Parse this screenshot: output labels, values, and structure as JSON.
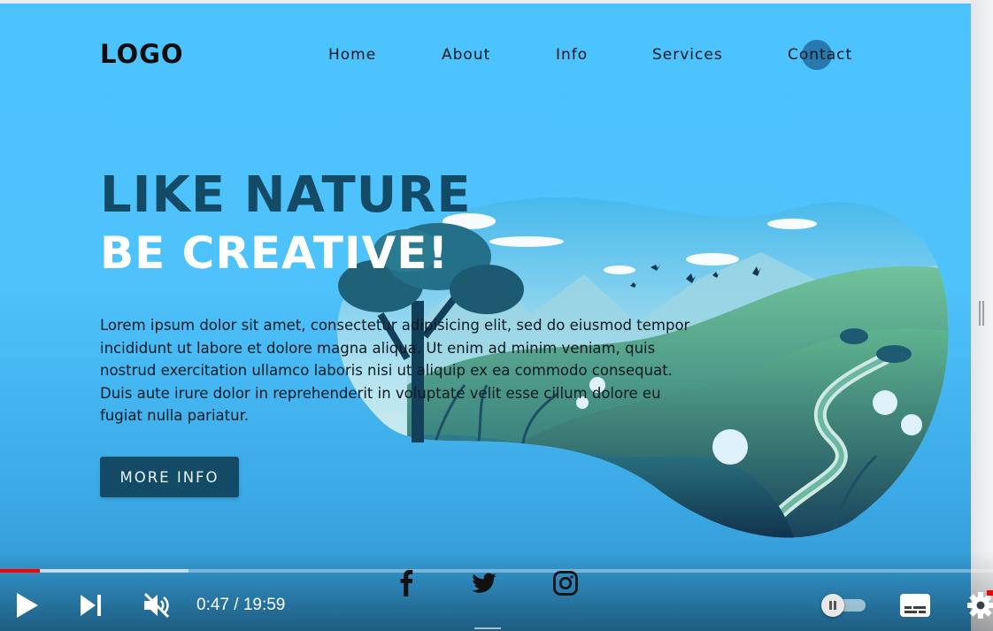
{
  "site": {
    "logo": "LOGO",
    "nav": [
      "Home",
      "About",
      "Info",
      "Services",
      "Contact"
    ],
    "hero": {
      "title": "LIKE NATURE",
      "subtitle": "BE CREATIVE!",
      "paragraph": [
        "Lorem ipsum dolor sit amet, consectetur adipisicing elit, sed do eiusmod tempor",
        "incididunt ut labore et dolore magna aliqua. Ut enim ad minim veniam, quis",
        "nostrud exercitation ullamco laboris nisi ut aliquip ex ea commodo consequat.",
        "Duis aute irure dolor in reprehenderit in voluptate velit esse cillum dolore eu",
        "fugiat nulla pariatur."
      ],
      "button": "MORE INFO"
    },
    "social_icons": [
      "facebook-icon",
      "twitter-icon",
      "instagram-icon"
    ]
  },
  "player": {
    "current_time": "0:47",
    "duration": "19:59",
    "time_display": "0:47 / 19:59",
    "played_fraction": 0.04,
    "buffered_fraction": 0.19,
    "muted": true,
    "autoplay_on": false,
    "icons": [
      "play-icon",
      "next-icon",
      "mute-icon",
      "autoplay-toggle",
      "captions-icon",
      "settings-icon"
    ]
  },
  "colors": {
    "background": "#4cc3fc",
    "heading_dark": "#134a66",
    "heading_light": "#ffffff",
    "button_bg": "#134a66",
    "progress_played": "#ff0000"
  }
}
